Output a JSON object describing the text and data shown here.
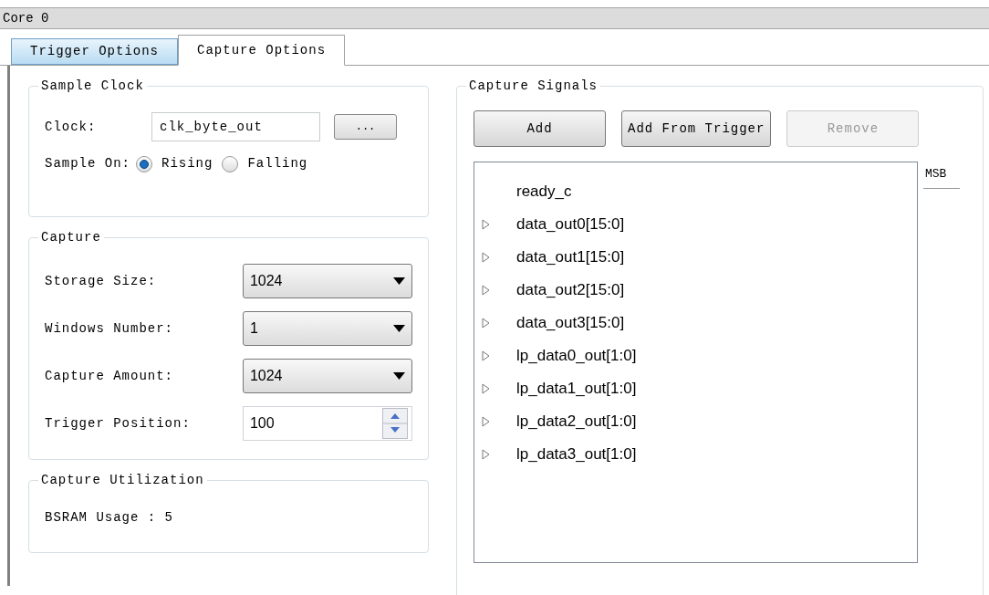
{
  "panel": {
    "title": "Core 0"
  },
  "tabs": [
    {
      "label": "Trigger Options",
      "selected": false
    },
    {
      "label": "Capture Options",
      "selected": true
    }
  ],
  "sample_clock": {
    "title": "Sample Clock",
    "clock_label": "Clock:",
    "clock_value": "clk_byte_out",
    "browse_button": "...",
    "sample_on_label": "Sample On:",
    "options": [
      {
        "label": "Rising",
        "selected": true
      },
      {
        "label": "Falling",
        "selected": false
      }
    ]
  },
  "capture": {
    "title": "Capture",
    "fields": [
      {
        "kind": "dropdown",
        "label": "Storage Size:",
        "value": "1024"
      },
      {
        "kind": "dropdown",
        "label": "Windows Number:",
        "value": "1"
      },
      {
        "kind": "dropdown",
        "label": "Capture Amount:",
        "value": "1024"
      },
      {
        "kind": "spinner",
        "label": "Trigger Position:",
        "value": "100"
      }
    ]
  },
  "capture_utilization": {
    "title": "Capture Utilization",
    "text": "BSRAM Usage : 5"
  },
  "capture_signals": {
    "title": "Capture Signals",
    "buttons": [
      {
        "label": "Add",
        "disabled": false
      },
      {
        "label": "Add From Trigger",
        "disabled": false
      },
      {
        "label": "Remove",
        "disabled": true
      }
    ],
    "column_header": "MSB",
    "signals": [
      {
        "name": "ready_c",
        "expandable": false
      },
      {
        "name": "data_out0[15:0]",
        "expandable": true
      },
      {
        "name": "data_out1[15:0]",
        "expandable": true
      },
      {
        "name": "data_out2[15:0]",
        "expandable": true
      },
      {
        "name": "data_out3[15:0]",
        "expandable": true
      },
      {
        "name": "lp_data0_out[1:0]",
        "expandable": true
      },
      {
        "name": "lp_data1_out[1:0]",
        "expandable": true
      },
      {
        "name": "lp_data2_out[1:0]",
        "expandable": true
      },
      {
        "name": "lp_data3_out[1:0]",
        "expandable": true
      }
    ]
  }
}
